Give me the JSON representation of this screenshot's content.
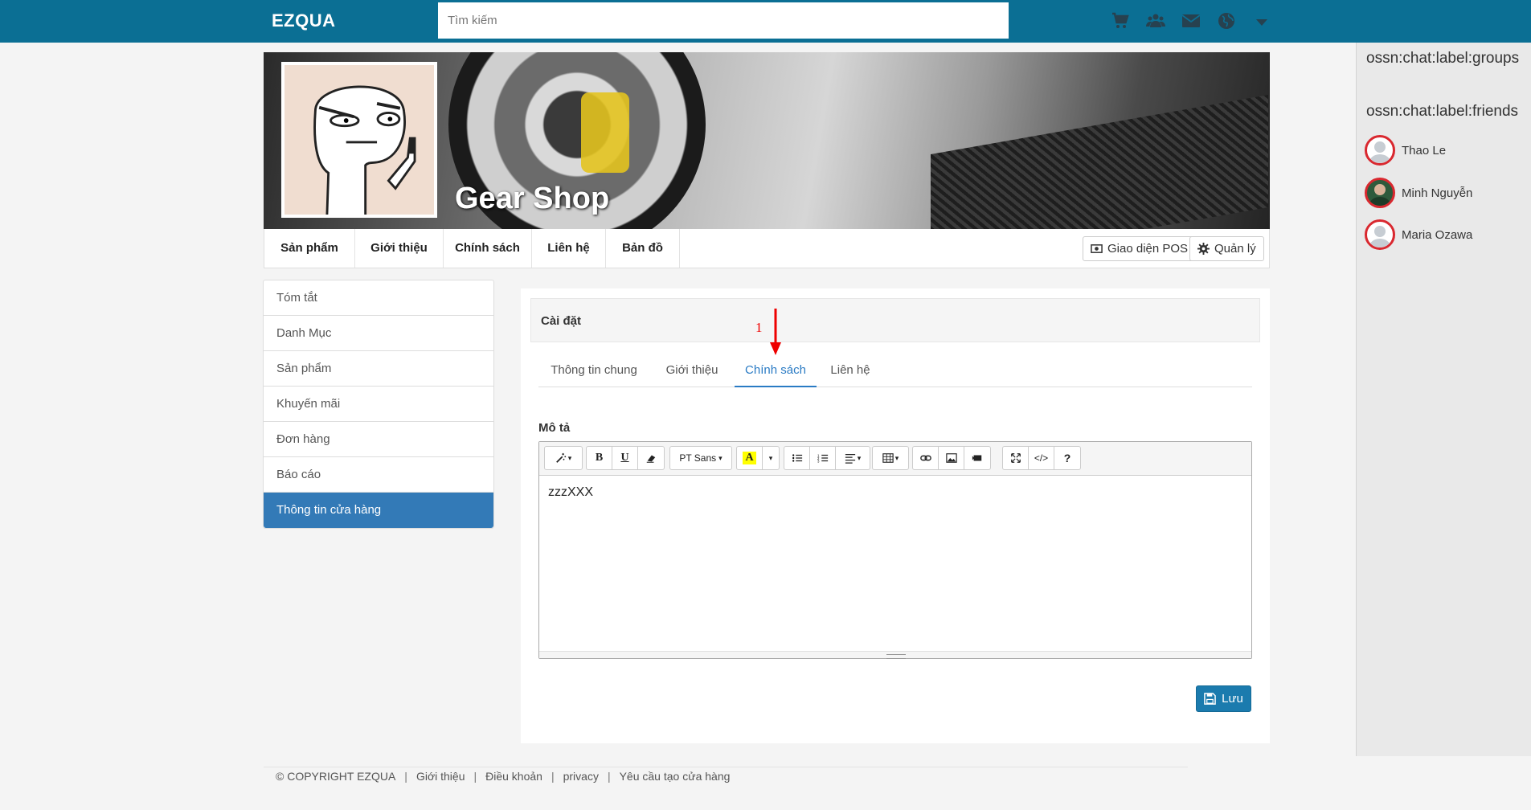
{
  "header": {
    "logo": "EZQUA",
    "search_placeholder": "Tìm kiếm",
    "icons": [
      "cart-icon",
      "users-icon",
      "envelope-icon",
      "globe-icon",
      "caret-down-icon"
    ]
  },
  "profile": {
    "shop_name": "Gear Shop",
    "nav": [
      "Sản phẩm",
      "Giới thiệu",
      "Chính sách",
      "Liên hệ",
      "Bản đồ"
    ],
    "pos_button": "Giao diện POS",
    "manage_button": "Quản lý"
  },
  "left_menu": {
    "items": [
      "Tóm tắt",
      "Danh Mục",
      "Sản phẩm",
      "Khuyến mãi",
      "Đơn hàng",
      "Báo cáo",
      "Thông tin cửa hàng"
    ],
    "active_index": 6
  },
  "settings": {
    "title": "Cài đặt",
    "tabs": [
      "Thông tin chung",
      "Giới thiệu",
      "Chính sách",
      "Liên hệ"
    ],
    "active_tab": "Chính sách",
    "annotation": "1",
    "field_label": "Mô tả",
    "editor": {
      "font_name": "PT Sans",
      "content": "zzzXXX",
      "highlight_color": "#ffff00"
    },
    "save_button": "Lưu"
  },
  "chat": {
    "groups_label": "ossn:chat:label:groups",
    "friends_label": "ossn:chat:label:friends",
    "friends": [
      {
        "name": "Thao Le"
      },
      {
        "name": "Minh Nguyễn"
      },
      {
        "name": "Maria Ozawa"
      }
    ]
  },
  "footer": {
    "copyright": "© COPYRIGHT EZQUA",
    "links": [
      "Giới thiệu",
      "Điều khoản",
      "privacy",
      "Yêu cầu tạo cửa hàng"
    ]
  },
  "colors": {
    "topbar": "#0b6f94",
    "active_menu": "#337ab7",
    "active_tab": "#2a7bc4",
    "save_button": "#1b7bae",
    "annotation": "#e00000"
  }
}
